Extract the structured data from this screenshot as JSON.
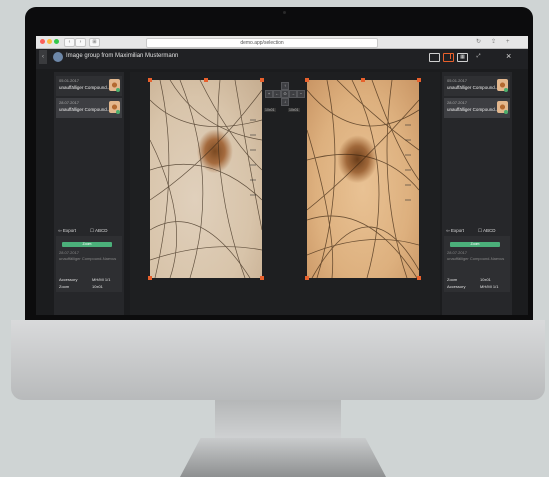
{
  "browser": {
    "url": "demo.app/selection",
    "nav_back": "‹",
    "nav_forward": "›",
    "tab_icon": "⊞"
  },
  "header": {
    "title": "Image group from Maximilian Mustermann",
    "collapse_icon": "‹",
    "close_icon": "×",
    "view_icons": [
      "single-view-icon",
      "compare-view-icon",
      "grid-view-icon",
      "fullscreen-icon"
    ]
  },
  "left_panel": {
    "cards": [
      {
        "date": "05.01.2017",
        "name": "unauffälliger Compound...",
        "selected": false
      },
      {
        "date": "28.07.2017",
        "name": "unauffälliger Compound...",
        "selected": true
      }
    ],
    "export_label": "Export",
    "abcd_label": "ABCD",
    "action_label": "Zoom",
    "rows": [
      "28.07.2017",
      "unauffälliger Compound-Naevus",
      "",
      ""
    ],
    "stat_labels": [
      "Accessory",
      "Zoom"
    ],
    "stat_values": [
      "MH/MI 1/1",
      "10x01"
    ]
  },
  "right_panel": {
    "cards": [
      {
        "date": "05.01.2017",
        "name": "unauffälliger Compound...",
        "selected": false
      },
      {
        "date": "28.07.2017",
        "name": "unauffälliger Compound...",
        "selected": true
      }
    ],
    "export_label": "Export",
    "abcd_label": "ABCD",
    "action_label": "Zoom",
    "rows": [
      "28.07.2017",
      "unauffälliger Compound-Naevus",
      "",
      ""
    ],
    "stat_labels": [
      "Zoom",
      "Accessory"
    ],
    "stat_values": [
      "10x01",
      "MH/MI 1/1"
    ]
  },
  "viewer": {
    "controls": [
      "↑",
      "←",
      "⊙",
      "→",
      "↓",
      "+",
      "−"
    ],
    "zoom_left": "10x01",
    "zoom_right": "10x01"
  },
  "colors": {
    "accent": "#e8602c",
    "green": "#4bb07a"
  }
}
